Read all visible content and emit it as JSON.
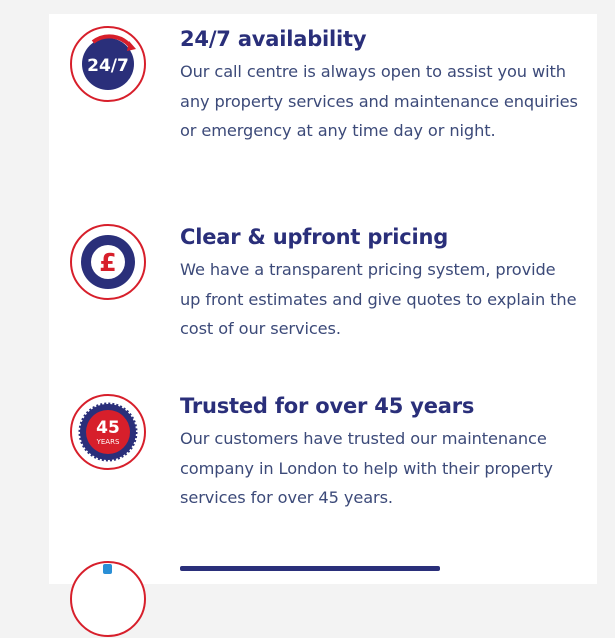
{
  "features": [
    {
      "icon": "clock-24-7-icon",
      "badge_text": "24/7",
      "title": "24/7 availability",
      "description": "Our call centre is always open to assist you with any property services and maintenance enquiries or emergency at any time day or night."
    },
    {
      "icon": "pound-sign-icon",
      "badge_text": "£",
      "title": "Clear & upfront pricing",
      "description": "We have a transparent pricing system, provide up front estimates and give quotes to explain the cost of our services."
    },
    {
      "icon": "45-years-seal-icon",
      "badge_text": "45",
      "badge_subtext": "YEARS",
      "title": "Trusted for over 45 years",
      "description": "Our customers have trusted our maintenance company in London to help with their property services for over 45 years."
    }
  ],
  "colors": {
    "navy": "#2a2f7a",
    "red": "#d71f2b",
    "text": "#3c4a79",
    "background": "#f3f3f3",
    "panel": "#ffffff"
  }
}
